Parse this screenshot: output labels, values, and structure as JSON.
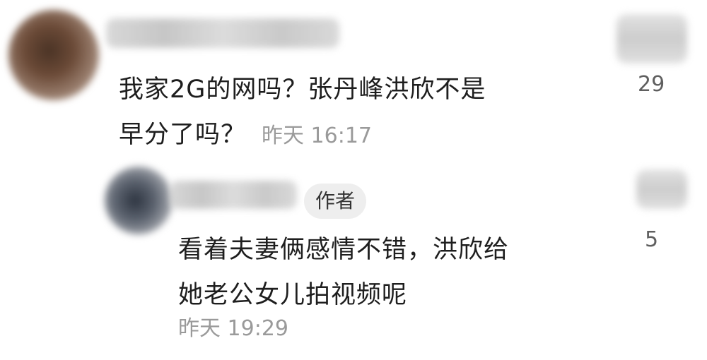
{
  "comment": {
    "line1": "我家2G的网吗？张丹峰洪欣不是",
    "line2": "早分了吗？",
    "time": "昨天 16:17",
    "likes": "29"
  },
  "reply": {
    "badge": "作者",
    "line1": "看着夫妻俩感情不错，洪欣给",
    "line2": "她老公女儿拍视频呢",
    "time": "昨天 19:29",
    "likes": "5"
  }
}
